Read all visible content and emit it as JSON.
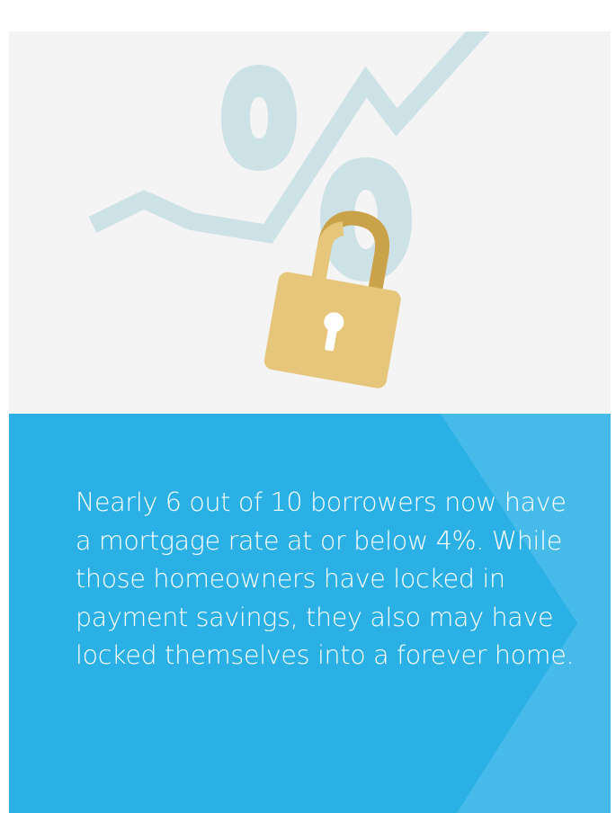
{
  "description_text": "Nearly 6 out of 10 borrowers now have a mortgage rate at or below 4%. While those homeowners have locked in payment savings, they also may have locked themselves into a forever home.",
  "icons": {
    "percent": "percent-icon",
    "trend_line": "trend-line-icon",
    "padlock": "padlock-icon"
  },
  "colors": {
    "illustration_bg": "#f4f4f4",
    "panel_bg": "#2bb0e6",
    "panel_chevron": "#46bbea",
    "trend_line": "#cde2e6",
    "padlock_body": "#e5c67a",
    "padlock_shackle": "#caa249"
  }
}
